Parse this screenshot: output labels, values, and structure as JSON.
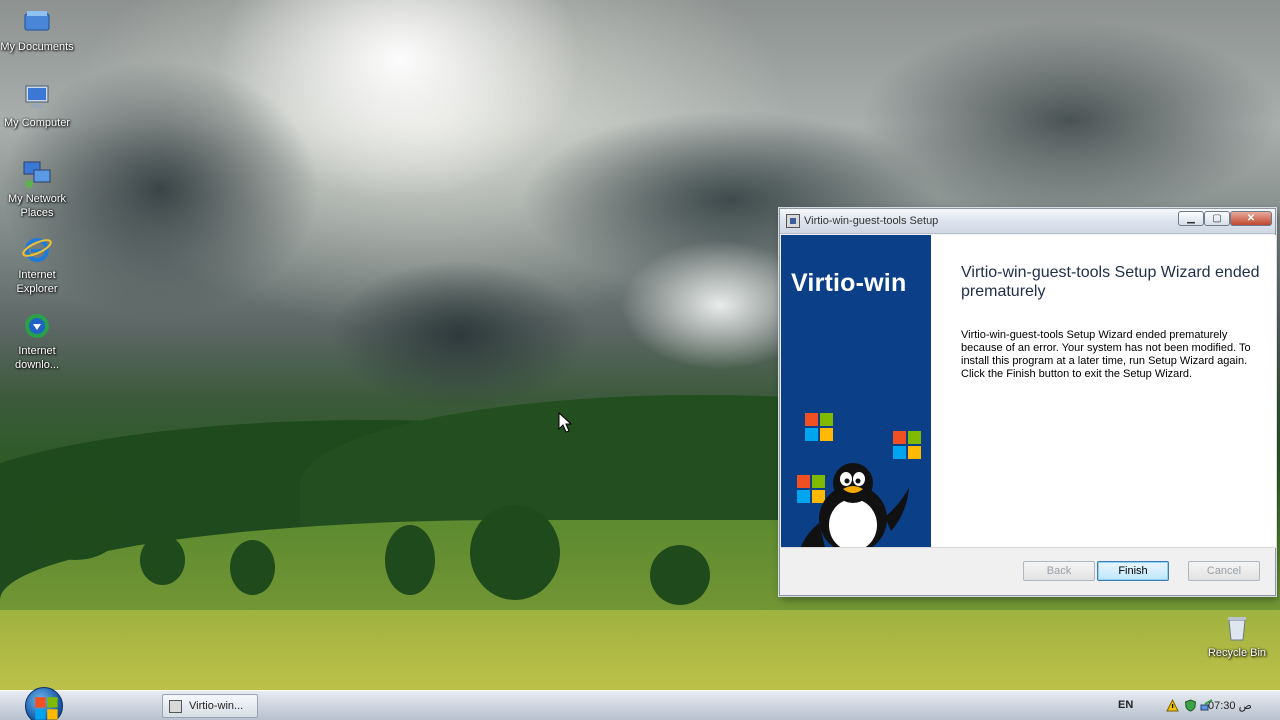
{
  "desktop": {
    "icons": [
      {
        "label": "My Documents",
        "icon": "my-documents-icon"
      },
      {
        "label": "My Computer",
        "icon": "my-computer-icon"
      },
      {
        "label": "My Network Places",
        "icon": "network-places-icon"
      },
      {
        "label": "Internet Explorer",
        "icon": "internet-explorer-icon"
      },
      {
        "label": "Internet downlo...",
        "icon": "download-manager-icon"
      },
      {
        "label": "Recycle Bin",
        "icon": "recycle-bin-icon"
      }
    ]
  },
  "window": {
    "title": "Virtio-win-guest-tools Setup",
    "controls": {
      "minimize": "▁",
      "maximize": "▢",
      "close": "✕"
    },
    "brand": "Virtio-win",
    "heading": "Virtio-win-guest-tools Setup Wizard ended prematurely",
    "message": "Virtio-win-guest-tools Setup Wizard ended prematurely because of an error. Your system has not been modified. To install this program at a later time, run Setup Wizard again. Click the Finish button to exit the Setup Wizard.",
    "buttons": {
      "back": "Back",
      "finish": "Finish",
      "cancel": "Cancel"
    }
  },
  "taskbar": {
    "task_label": "Virtio-win...",
    "language": "EN",
    "clock": "07:30 ص"
  },
  "colors": {
    "side_panel": "#0b3f88",
    "heading": "#1f2f4a"
  }
}
